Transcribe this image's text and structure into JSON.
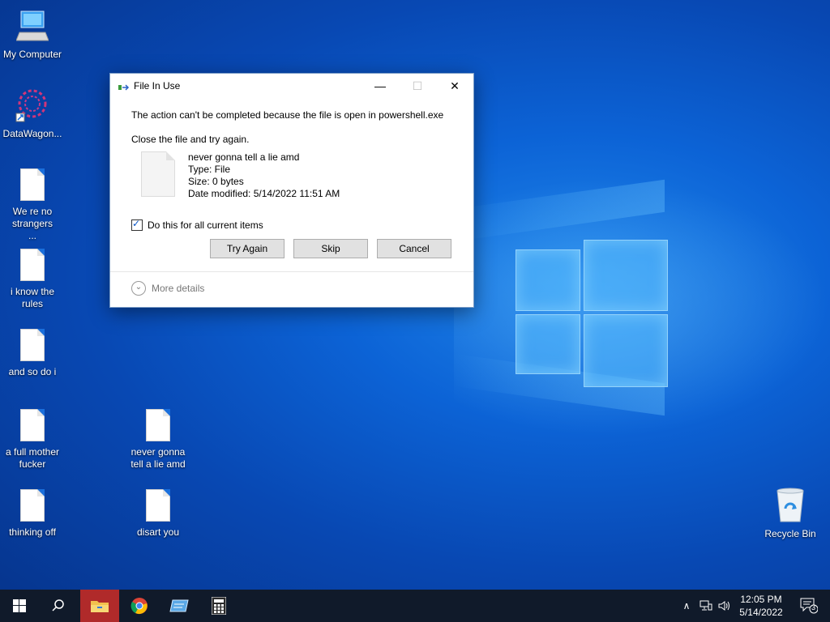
{
  "desktop": {
    "icons": [
      {
        "label": "My Computer",
        "type": "computer"
      },
      {
        "label": "DataWagon...",
        "type": "app"
      },
      {
        "label": "We re no strangers ...",
        "type": "file"
      },
      {
        "label": "i know the rules",
        "type": "file"
      },
      {
        "label": "and so do i",
        "type": "file"
      },
      {
        "label": "a full mother fucker",
        "type": "file"
      },
      {
        "label": "thinking off",
        "type": "file"
      },
      {
        "label": "never gonna tell a lie amd",
        "type": "file"
      },
      {
        "label": "disart you",
        "type": "file"
      },
      {
        "label": "Recycle Bin",
        "type": "recycle-bin"
      }
    ]
  },
  "dialog": {
    "title": "File In Use",
    "message": "The action can't be completed because the file is open in powershell.exe",
    "instruction": "Close the file and try again.",
    "file": {
      "name": "never gonna tell a lie amd",
      "type_line": "Type: File",
      "size_line": "Size: 0 bytes",
      "date_line": "Date modified: 5/14/2022 11:51 AM"
    },
    "checkbox_label": "Do this for all current items",
    "checkbox_checked": true,
    "buttons": {
      "try_again": "Try Again",
      "skip": "Skip",
      "cancel": "Cancel"
    },
    "more_details": "More details",
    "controls": {
      "minimize": "—",
      "maximize": "☐",
      "close": "✕"
    }
  },
  "taskbar": {
    "apps": [
      "start-icon",
      "search-icon",
      "file-explorer-icon",
      "chrome-icon",
      "app-icon",
      "calculator-icon"
    ],
    "tray": {
      "chevron": "∧",
      "notification_count": "3"
    },
    "clock": {
      "time": "12:05 PM",
      "date": "5/14/2022"
    }
  },
  "colors": {
    "accent": "#0a55c6",
    "taskbar": "#101a2a",
    "active_app": "#b02a2a"
  }
}
